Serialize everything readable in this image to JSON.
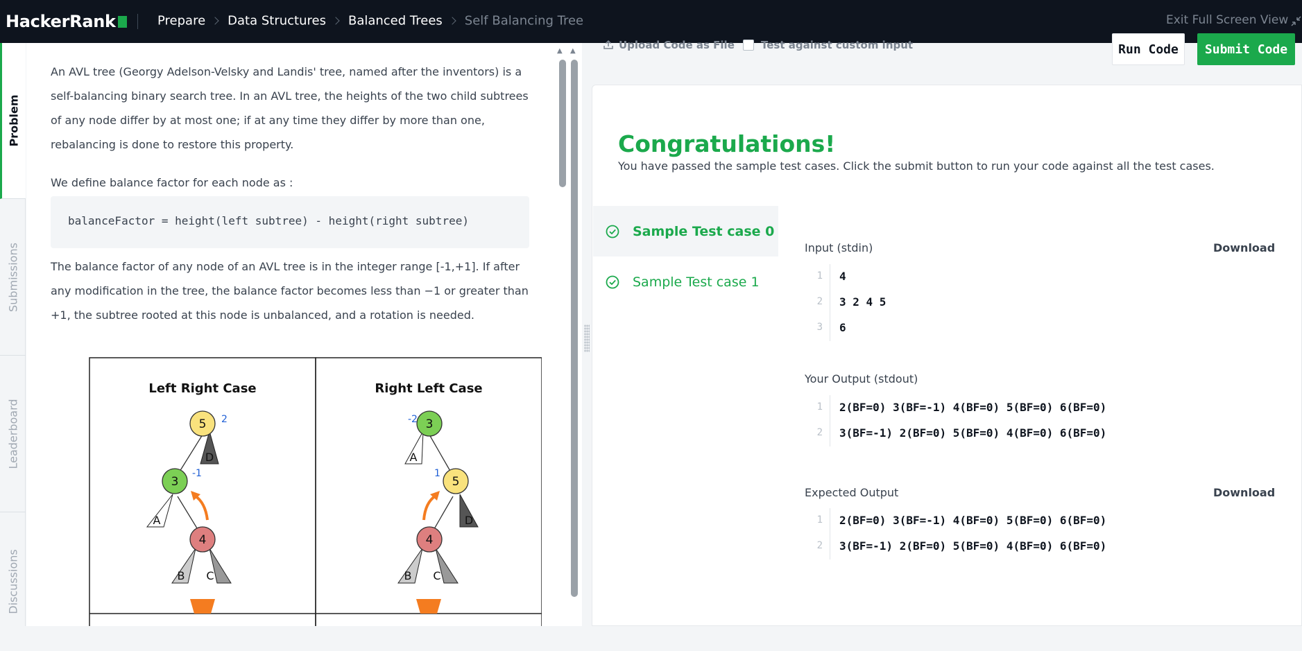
{
  "header": {
    "logo": "HackerRank",
    "breadcrumb": [
      "Prepare",
      "Data Structures",
      "Balanced Trees",
      "Self Balancing Tree"
    ],
    "exit_fullscreen": "Exit Full Screen View"
  },
  "side_tabs": [
    "Problem",
    "Submissions",
    "Leaderboard",
    "Discussions"
  ],
  "problem": {
    "p1": "An AVL tree (Georgy Adelson-Velsky and Landis' tree, named after the inventors) is a self-balancing binary search tree. In an AVL tree, the heights of the two child subtrees of any node differ by at most one; if at any time they differ by more than one, rebalancing is done to restore this property.",
    "p2": "We define balance factor for each node as :",
    "code": "balanceFactor = height(left subtree) - height(right subtree)",
    "p3": "The balance factor of any node of an AVL tree is in the integer range [-1,+1]. If after any modification in the tree, the balance factor becomes less than −1 or greater than +1, the subtree rooted at this node is unbalanced, and a rotation is needed.",
    "diagram": {
      "left_title": "Left Right Case",
      "right_title": "Right Left Case",
      "left": {
        "n5": "5",
        "n3": "3",
        "n4": "4",
        "bf5": "2",
        "bf3": "-1",
        "A": "A",
        "B": "B",
        "C": "C",
        "D": "D"
      },
      "right": {
        "n3": "3",
        "n5": "5",
        "n4": "4",
        "bf3": "-2",
        "bf5": "1",
        "A": "A",
        "B": "B",
        "C": "C",
        "D": "D"
      },
      "colors": {
        "yellow": "#f9e27d",
        "green": "#7ccf55",
        "red": "#de7f7f",
        "orange": "#f47c20",
        "bf_text": "#1f5fd6"
      }
    }
  },
  "editor_toolbar": {
    "upload": "Upload Code as File",
    "custom_input": "Test against custom input",
    "run": "Run Code",
    "submit": "Submit Code"
  },
  "results": {
    "title": "Congratulations!",
    "message": "You have passed the sample test cases. Click the submit button to run your code against all the test cases.",
    "testcases": [
      "Sample Test case 0",
      "Sample Test case 1"
    ],
    "input_label": "Input (stdin)",
    "output_label": "Your Output (stdout)",
    "expected_label": "Expected Output",
    "download": "Download",
    "input_lines": [
      "4",
      "3 2 4 5",
      "6"
    ],
    "output_lines": [
      "2(BF=0) 3(BF=-1) 4(BF=0) 5(BF=0) 6(BF=0)",
      "3(BF=-1) 2(BF=0) 5(BF=0) 4(BF=0) 6(BF=0)"
    ],
    "expected_lines": [
      "2(BF=0) 3(BF=-1) 4(BF=0) 5(BF=0) 6(BF=0)",
      "3(BF=-1) 2(BF=0) 5(BF=0) 4(BF=0) 6(BF=0)"
    ],
    "line_numbers": [
      "1",
      "2",
      "3"
    ]
  },
  "colors": {
    "brand_green": "#1ba94c",
    "topbar": "#0e141e"
  }
}
